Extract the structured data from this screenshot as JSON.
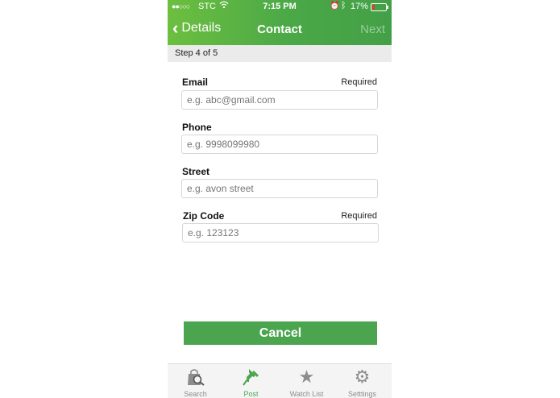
{
  "status_bar": {
    "signal": "●●○○○",
    "carrier": "STC",
    "time": "7:15 PM",
    "battery_percent": "17%",
    "battery_level": 0.17
  },
  "nav": {
    "back_label": "Details",
    "title": "Contact",
    "next_label": "Next"
  },
  "step": "Step 4 of 5",
  "form": {
    "email": {
      "label": "Email",
      "required": "Required",
      "placeholder": "e.g. abc@gmail.com"
    },
    "phone": {
      "label": "Phone",
      "placeholder": "e.g. 9998099980"
    },
    "street": {
      "label": "Street",
      "placeholder": "e.g. avon street"
    },
    "zip": {
      "label": "Zip Code",
      "required": "Required",
      "placeholder": "e.g. 123123"
    }
  },
  "cancel_label": "Cancel",
  "tabs": [
    {
      "label": "Search",
      "icon": "bag-search-icon"
    },
    {
      "label": "Post",
      "icon": "pushpin-icon",
      "active": true
    },
    {
      "label": "Watch List",
      "icon": "star-icon"
    },
    {
      "label": "Setttings",
      "icon": "gear-icon"
    }
  ],
  "colors": {
    "accent": "#4aa54e",
    "inactive_tab": "#8c8c8c"
  }
}
